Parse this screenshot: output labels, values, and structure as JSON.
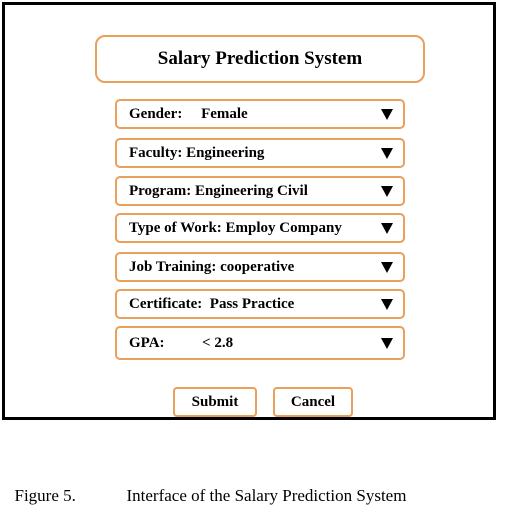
{
  "app": {
    "title": "Salary Prediction System"
  },
  "fields": [
    {
      "label": "Gender:",
      "value": "Female",
      "sep": "     "
    },
    {
      "label": "Faculty:",
      "value": "Engineering",
      "sep": " "
    },
    {
      "label": "Program:",
      "value": "Engineering Civil",
      "sep": " "
    },
    {
      "label": "Type of Work:",
      "value": "Employ Company",
      "sep": " "
    },
    {
      "label": "Job Training:",
      "value": "cooperative",
      "sep": " "
    },
    {
      "label": "Certificate:",
      "value": "Pass Practice",
      "sep": "  "
    },
    {
      "label": "GPA:",
      "value": "< 2.8",
      "sep": "          "
    }
  ],
  "buttons": {
    "submit_label": "Submit",
    "cancel_label": "Cancel"
  },
  "caption": {
    "number": "Figure 5.",
    "text": "Interface of the Salary Prediction System"
  },
  "colors": {
    "border_accent": "#e8a05a",
    "frame": "#000000"
  },
  "icons": {
    "dropdown": "triangle-down-icon"
  }
}
